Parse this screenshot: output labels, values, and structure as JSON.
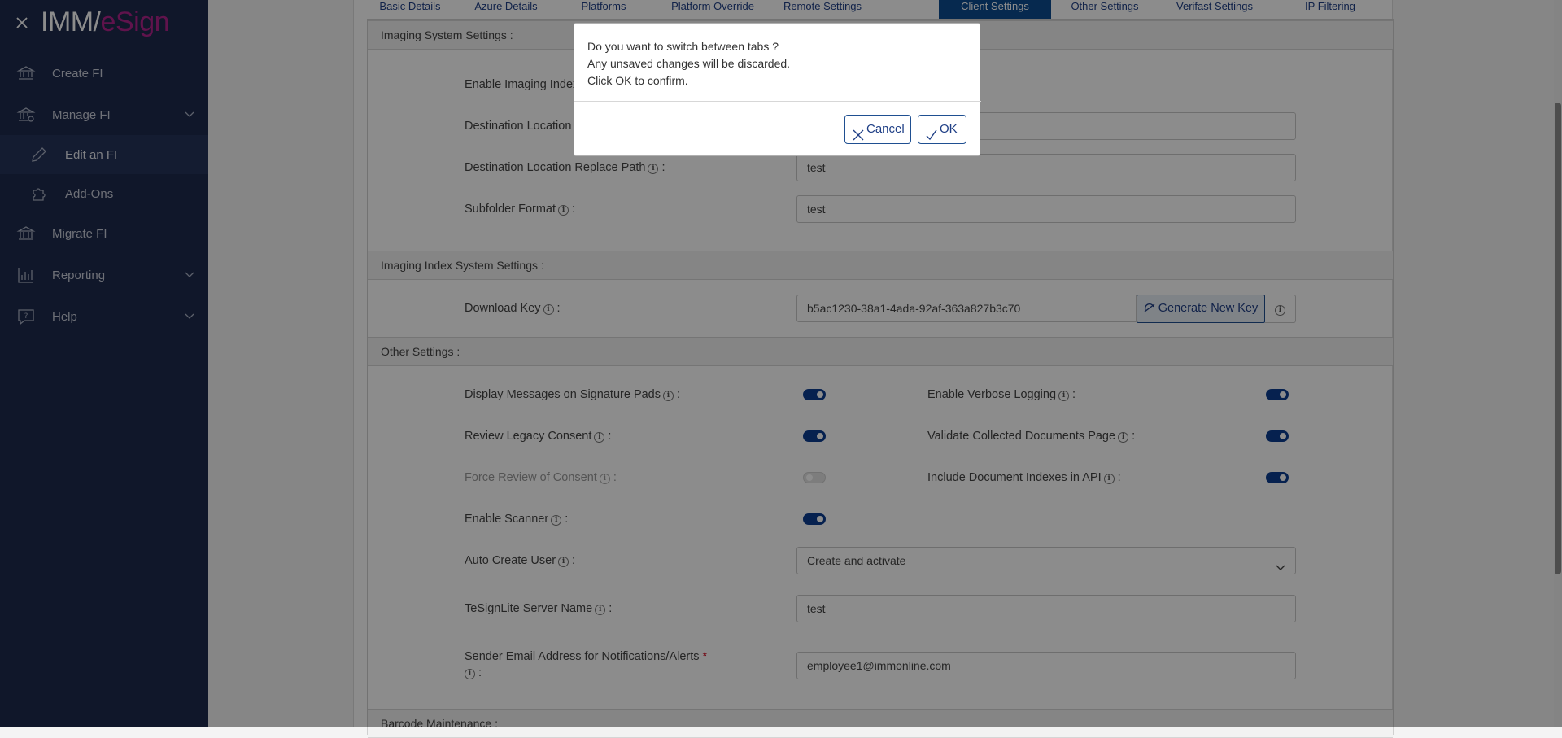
{
  "brand": {
    "imm": "IMM",
    "slash": "/",
    "esign": "eSign"
  },
  "sidebar": {
    "items": [
      {
        "label": "Create FI",
        "icon": "bank-icon"
      },
      {
        "label": "Manage FI",
        "icon": "bank-gear-icon"
      },
      {
        "label": "Edit an FI",
        "icon": "pencil-icon"
      },
      {
        "label": "Add-Ons",
        "icon": "puzzle-icon"
      },
      {
        "label": "Migrate FI",
        "icon": "bank-icon"
      },
      {
        "label": "Reporting",
        "icon": "bar-chart-icon"
      },
      {
        "label": "Help",
        "icon": "help-chat-icon"
      }
    ]
  },
  "tabs": [
    "Basic Details",
    "Azure Details",
    "Platforms",
    "Platform Override",
    "Remote Settings",
    "Client Settings",
    "Other Settings",
    "Verifast Settings",
    "IP Filtering"
  ],
  "active_tab": "Client Settings",
  "sections": {
    "imaging_system": "Imaging System Settings :",
    "imaging_index": "Imaging Index System Settings :",
    "other": "Other Settings :",
    "barcode": "Barcode Maintenance :"
  },
  "imaging_system": {
    "enable_index_label": "Enable Imaging Index",
    "dest_location_label": "Destination Location",
    "dest_replace_label": "Destination Location Replace Path",
    "dest_replace_value": "test",
    "subfolder_label": "Subfolder Format",
    "subfolder_value": "test"
  },
  "imaging_index": {
    "download_key_label": "Download Key",
    "download_key_value": "b5ac1230-38a1-4ada-92af-363a827b3c70",
    "generate_button": "Generate New Key"
  },
  "other": {
    "display_messages_label": "Display Messages on Signature Pads",
    "verbose_logging_label": "Enable Verbose Logging",
    "legacy_consent_label": "Review Legacy Consent",
    "validate_docs_label": "Validate Collected Documents Page",
    "force_review_label": "Force Review of Consent",
    "include_indexes_label": "Include Document Indexes in API",
    "enable_scanner_label": "Enable Scanner",
    "auto_create_label": "Auto Create User",
    "auto_create_value": "Create and activate",
    "server_name_label": "TeSignLite Server Name",
    "server_name_value": "test",
    "sender_email_label": "Sender Email Address for Notifications/Alerts",
    "sender_email_value": "employee1@immonline.com",
    "toggles": {
      "display_messages": true,
      "verbose_logging": true,
      "legacy_consent": true,
      "validate_docs": true,
      "force_review": false,
      "include_indexes": true,
      "enable_scanner": true
    }
  },
  "modal": {
    "line1": "Do you want to switch between tabs ?",
    "line2": "Any unsaved changes will be discarded.",
    "line3": "Click OK to confirm.",
    "cancel": "Cancel",
    "ok": "OK"
  },
  "colors": {
    "sidebar": "#1e2a4d",
    "accent": "#0b4b91",
    "brand_pink": "#b0248a"
  }
}
